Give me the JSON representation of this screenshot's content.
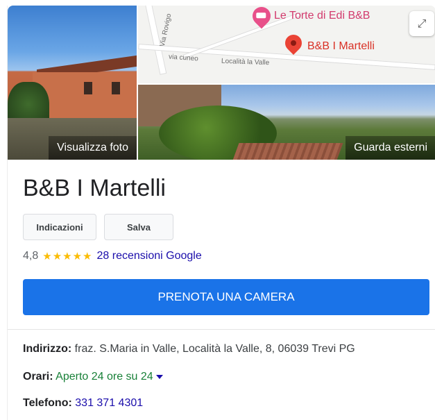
{
  "photos": {
    "main_label": "Visualizza foto",
    "exterior_label": "Guarda esterni"
  },
  "map": {
    "poi_nearby": "Le Torte di Edi B&B",
    "poi_main": "B&B I Martelli",
    "roads": [
      "Via Rovigo",
      "via cuneo",
      "Località la Valle"
    ]
  },
  "place": {
    "name": "B&B I Martelli",
    "rating": "4,8",
    "stars": "★★★★★",
    "reviews_label": "28 recensioni Google"
  },
  "actions": {
    "directions_label": "Indicazioni",
    "save_label": "Salva",
    "book_label": "PRENOTA UNA CAMERA"
  },
  "details": {
    "address_label": "Indirizzo:",
    "address_value": "fraz. S.Maria in Valle, Località la Valle, 8, 06039 Trevi PG",
    "hours_label": "Orari:",
    "hours_value": "Aperto 24 ore su 24",
    "phone_label": "Telefono:",
    "phone_value": "331 371 4301"
  },
  "colors": {
    "primary_button": "#1a73e8",
    "star": "#fbbc04",
    "link": "#1a0dab",
    "open_green": "#188038"
  }
}
